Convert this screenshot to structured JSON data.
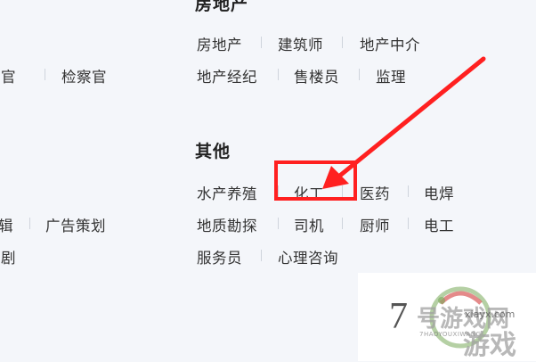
{
  "sections": {
    "real_estate": {
      "title": "房地产",
      "row1": [
        "房地产",
        "建筑师",
        "地产中介"
      ],
      "row2": [
        "地产经纪",
        "售楼员",
        "监理"
      ]
    },
    "other": {
      "title": "其他",
      "row1": [
        "水产养殖",
        "化工",
        "医药",
        "电焊"
      ],
      "row2": [
        "地质勘探",
        "司机",
        "厨师",
        "电工"
      ],
      "row3": [
        "服务员",
        "心理咨询"
      ]
    },
    "left_partial": {
      "row1": [
        "法官",
        "检察官"
      ],
      "row2": [
        "辑",
        "广告策划"
      ],
      "row3": [
        "编剧"
      ]
    }
  },
  "watermark": {
    "number": "7",
    "brand": "号游戏网",
    "pinyin": "7HAOYOUXIWANG",
    "url": "xiayx.com",
    "sub": "游戏"
  },
  "colors": {
    "background": "#f4f6fa",
    "annotation": "#ff2020",
    "separator": "#cfd4dc"
  }
}
